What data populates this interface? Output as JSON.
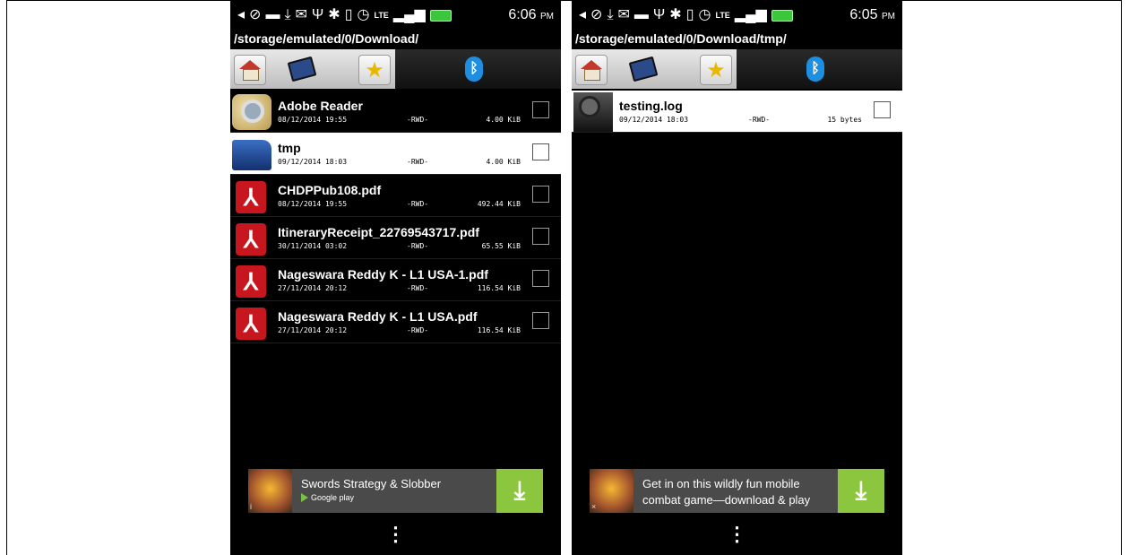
{
  "left": {
    "status_time": "6:06",
    "status_ampm": "PM",
    "path": "/storage/emulated/0/Download/",
    "files": [
      {
        "name": "Adobe Reader",
        "date": "08/12/2014 19:55",
        "perm": "-RWD-",
        "size": "4.00 KiB",
        "icon": "adobe-reader-icon"
      },
      {
        "name": "tmp",
        "date": "09/12/2014 18:03",
        "perm": "-RWD-",
        "size": "4.00 KiB",
        "icon": "folder-icon"
      },
      {
        "name": "CHDPPub108.pdf",
        "date": "08/12/2014 19:55",
        "perm": "-RWD-",
        "size": "492.44 KiB",
        "icon": "pdf-icon"
      },
      {
        "name": "ItineraryReceipt_22769543717.pdf",
        "date": "30/11/2014 03:02",
        "perm": "-RWD-",
        "size": "65.55 KiB",
        "icon": "pdf-icon"
      },
      {
        "name": "Nageswara Reddy K - L1 USA-1.pdf",
        "date": "27/11/2014 20:12",
        "perm": "-RWD-",
        "size": "116.54 KiB",
        "icon": "pdf-icon"
      },
      {
        "name": "Nageswara Reddy K - L1 USA.pdf",
        "date": "27/11/2014 20:12",
        "perm": "-RWD-",
        "size": "116.54 KiB",
        "icon": "pdf-icon"
      }
    ],
    "ad": {
      "text": "Swords Strategy & Slobber",
      "store": "Google play",
      "info": "i"
    }
  },
  "right": {
    "status_time": "6:05",
    "status_ampm": "PM",
    "path": "/storage/emulated/0/Download/tmp/",
    "files": [
      {
        "name": "testing.log",
        "date": "09/12/2014 18:03",
        "perm": "-RWD-",
        "size": "15 bytes",
        "icon": "log-file-icon"
      }
    ],
    "ad": {
      "text": "Get in on this wildly fun mobile combat game—download & play",
      "info": "×"
    }
  },
  "status_lte": "LTE",
  "menu_glyph": "⋮",
  "download_glyph": "⤓",
  "colors": {
    "selected_row": "#ffffff",
    "pdf_red": "#c7161e",
    "battery": "#3cc63c",
    "ad_download": "#8cc63f"
  }
}
